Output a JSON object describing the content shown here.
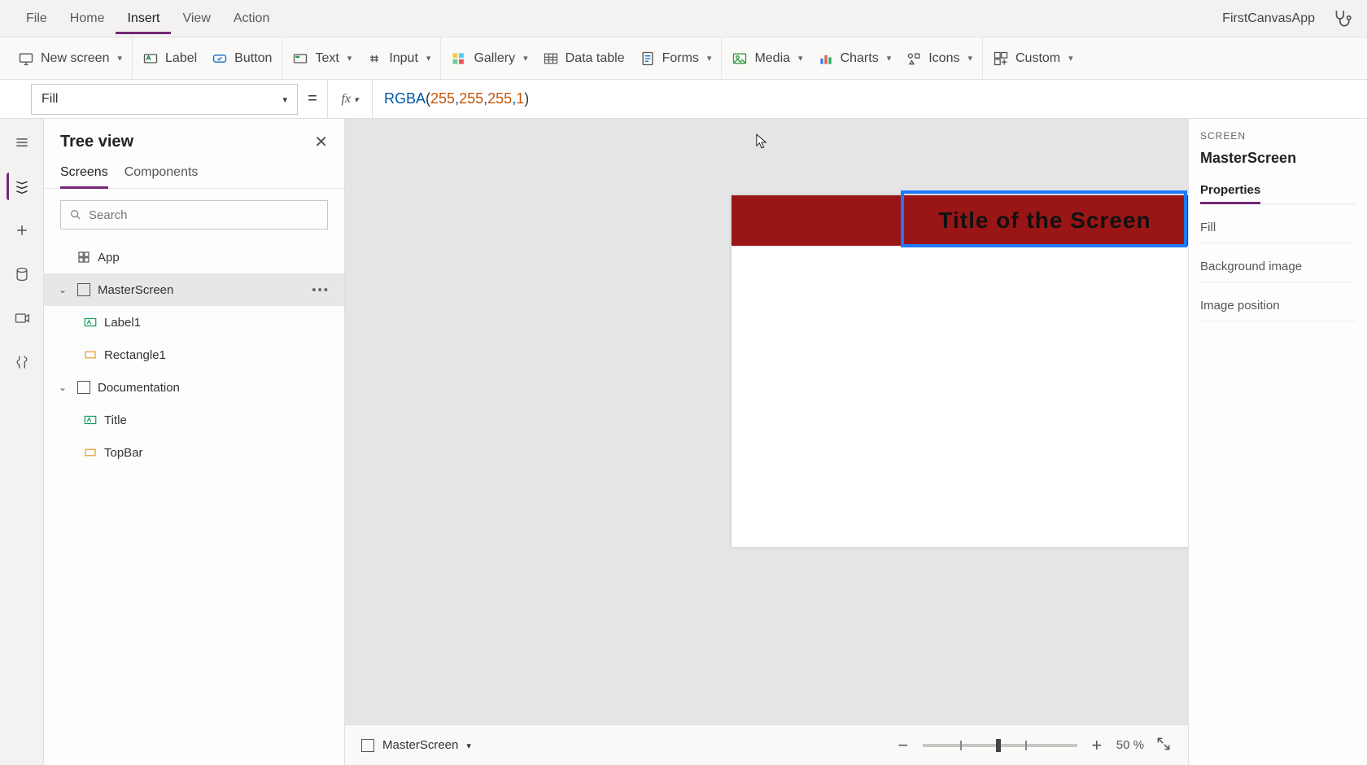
{
  "app_name": "FirstCanvasApp",
  "menu": {
    "items": [
      "File",
      "Home",
      "Insert",
      "View",
      "Action"
    ],
    "active": 2
  },
  "ribbon": {
    "new_screen": "New screen",
    "label": "Label",
    "button": "Button",
    "text": "Text",
    "input": "Input",
    "gallery": "Gallery",
    "data_table": "Data table",
    "forms": "Forms",
    "media": "Media",
    "charts": "Charts",
    "icons": "Icons",
    "custom": "Custom"
  },
  "formula": {
    "property": "Fill",
    "fx": "fx",
    "tokens": {
      "func": "RGBA",
      "open": "(",
      "n1": "255",
      "c1": ", ",
      "n2": "255",
      "c2": ", ",
      "n3": "255",
      "c3": ", ",
      "n4": "1",
      "close": ")"
    }
  },
  "treeview": {
    "title": "Tree view",
    "tabs": {
      "screens": "Screens",
      "components": "Components"
    },
    "search_placeholder": "Search",
    "nodes": {
      "app": "App",
      "master": "MasterScreen",
      "label1": "Label1",
      "rect1": "Rectangle1",
      "doc": "Documentation",
      "title": "Title",
      "topbar": "TopBar"
    }
  },
  "canvas": {
    "title_text": "Title of the Screen",
    "topbar_color": "#9a1515"
  },
  "footer": {
    "screen": "MasterScreen",
    "zoom_value": "50",
    "zoom_unit": "%"
  },
  "properties": {
    "kind": "SCREEN",
    "name": "MasterScreen",
    "tab_properties": "Properties",
    "rows": [
      "Fill",
      "Background image",
      "Image position"
    ]
  }
}
